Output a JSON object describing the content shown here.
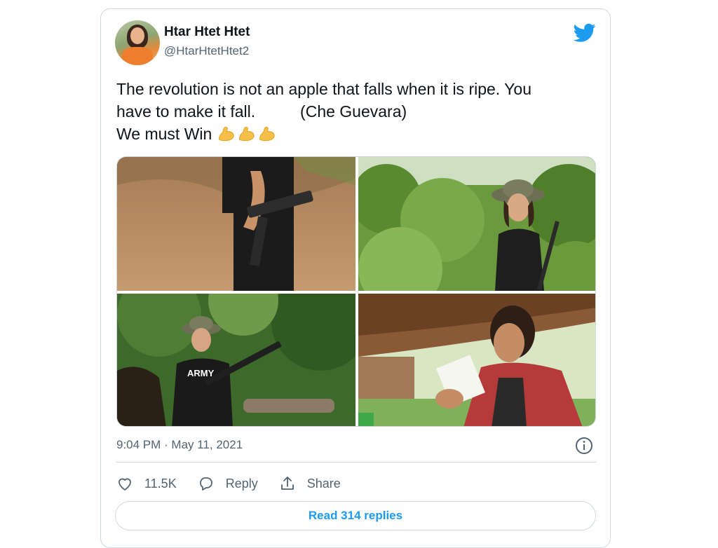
{
  "user": {
    "name": "Htar Htet Htet",
    "handle": "@HtarHtetHtet2"
  },
  "tweet": {
    "line1": "The revolution is not an apple that falls when it is ripe. You",
    "line2": "have to make it fall.          (Che Guevara)",
    "line3": "We must Win ",
    "emoji": [
      "flexed-biceps",
      "flexed-biceps",
      "flexed-biceps"
    ]
  },
  "media": [
    {
      "name": "photo-rifle-closeup"
    },
    {
      "name": "photo-woman-forest"
    },
    {
      "name": "photo-army-shirt-rifle"
    },
    {
      "name": "photo-woman-reading-note"
    }
  ],
  "timestamp": "9:04 PM · May 11, 2021",
  "actions": {
    "like_count": "11.5K",
    "reply_label": "Reply",
    "share_label": "Share"
  },
  "read_replies_label": "Read 314 replies",
  "colors": {
    "accent": "#1d9bf0",
    "text": "#0f1419",
    "secondary": "#536471",
    "border": "#cfd9de"
  },
  "icons": [
    "twitter-bird-icon",
    "info-icon",
    "heart-icon",
    "reply-icon",
    "share-icon"
  ]
}
